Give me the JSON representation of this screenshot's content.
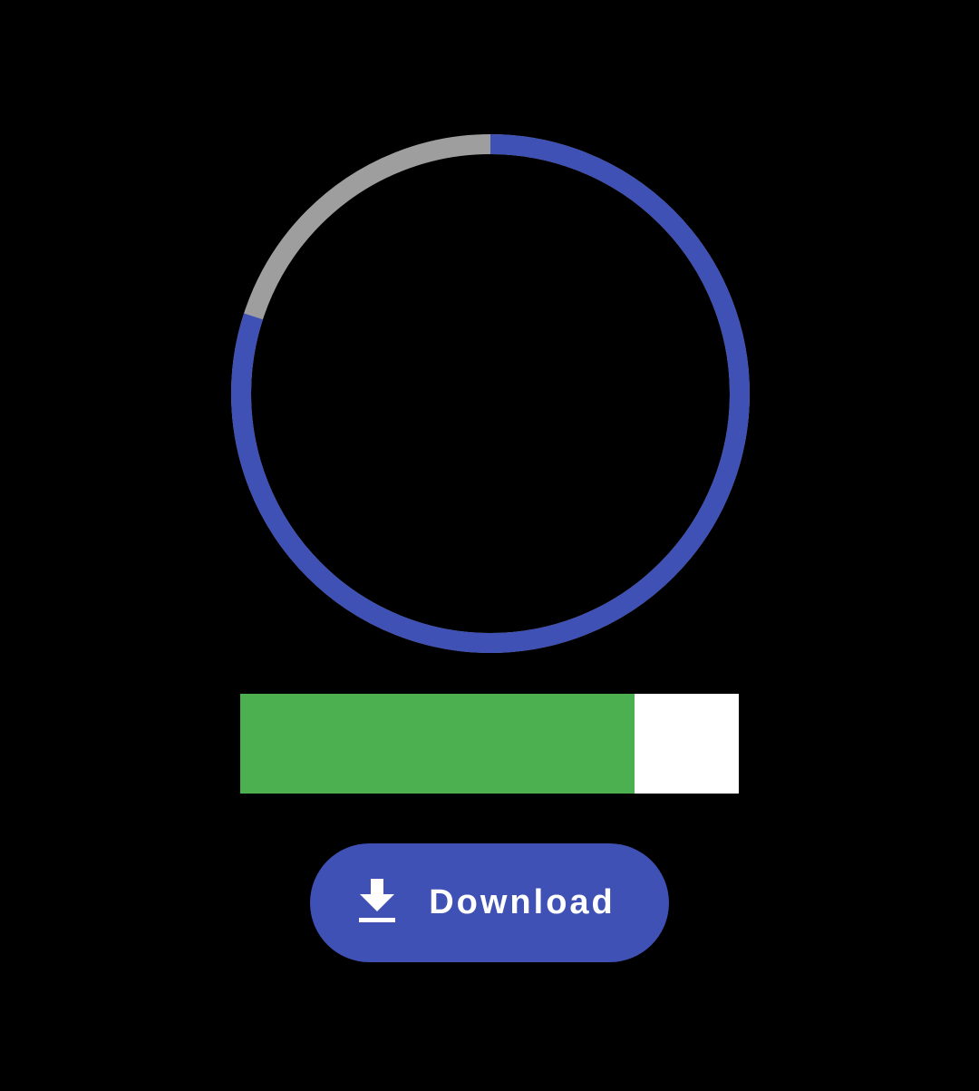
{
  "colors": {
    "background": "#000000",
    "accent": "#3f51b5",
    "ring_track": "#9e9e9e",
    "bar_fill": "#4caf50",
    "bar_track": "#ffffff",
    "button_text": "#ffffff"
  },
  "circular_progress": {
    "value_fraction": 0.8
  },
  "linear_progress": {
    "value_fraction": 0.79
  },
  "download_button": {
    "label": "Download",
    "icon": "download-icon"
  }
}
